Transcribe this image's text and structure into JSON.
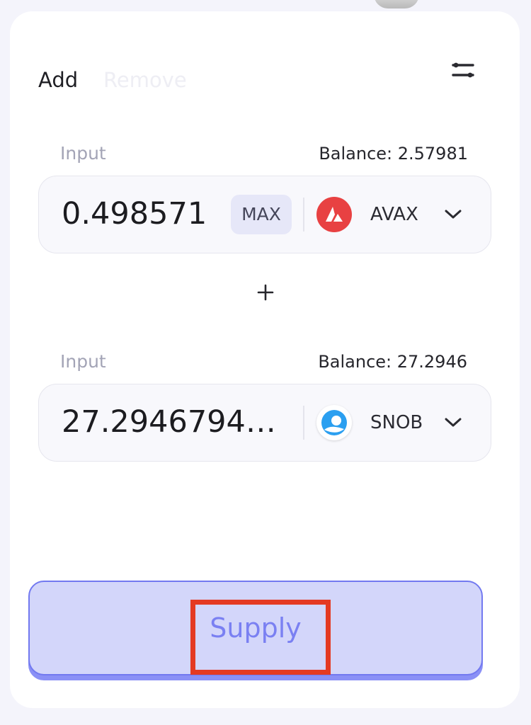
{
  "tabs": {
    "add_label": "Add",
    "remove_label": "Remove"
  },
  "settings": {
    "icon": "sliders-icon"
  },
  "first_input": {
    "label": "Input",
    "balance": "Balance: 2.57981",
    "amount": "0.498571",
    "max_label": "MAX",
    "token": {
      "symbol": "AVAX",
      "icon": "avax-logo",
      "color": "#e84142"
    }
  },
  "plus": {
    "icon": "plus-icon"
  },
  "second_input": {
    "label": "Input",
    "balance": "Balance: 27.2946",
    "amount": "27.29467940...",
    "token": {
      "symbol": "SNOB",
      "icon": "snob-logo",
      "color": "#2b9ff0"
    }
  },
  "supply": {
    "label": "Supply",
    "accent_color": "#7279f0",
    "background_color": "#d3d6fa",
    "highlight_color": "#e43a22"
  }
}
